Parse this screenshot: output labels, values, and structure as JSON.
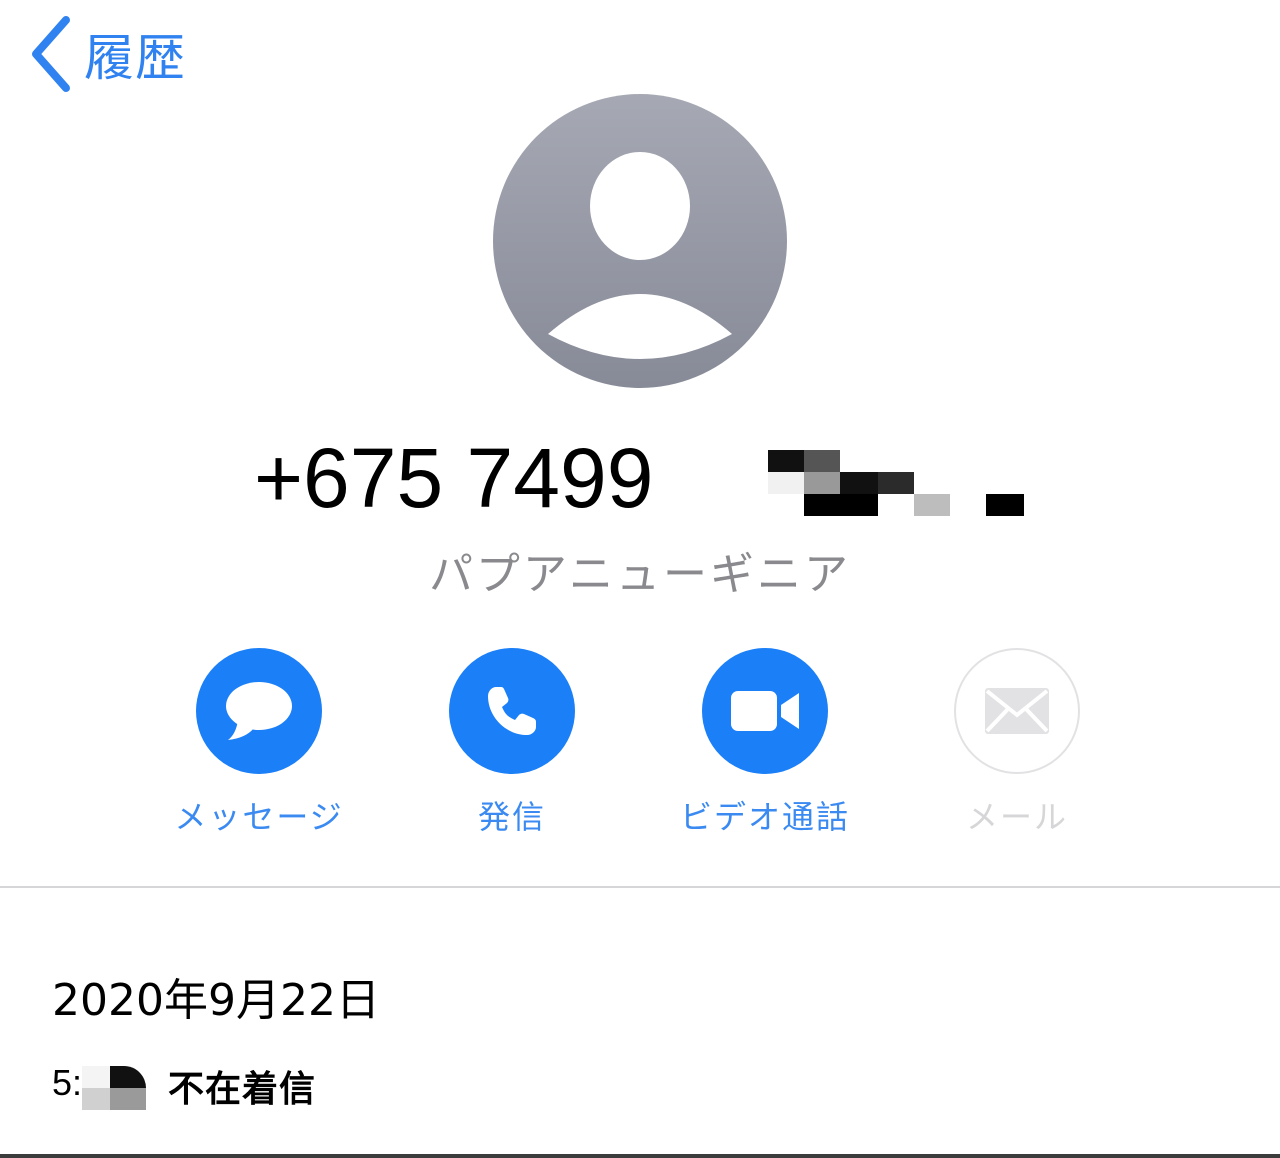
{
  "nav": {
    "back_label": "履歴"
  },
  "contact": {
    "phone_number": "+675 7499",
    "country": "パプアニューギニア"
  },
  "actions": [
    {
      "label": "メッセージ",
      "icon": "message-bubble-icon",
      "enabled": true
    },
    {
      "label": "発信",
      "icon": "phone-icon",
      "enabled": true
    },
    {
      "label": "ビデオ通話",
      "icon": "video-camera-icon",
      "enabled": true
    },
    {
      "label": "メール",
      "icon": "envelope-icon",
      "enabled": false
    }
  ],
  "history": {
    "date": "2020年9月22日",
    "calls": [
      {
        "time": "5:",
        "status": "不在着信"
      }
    ]
  },
  "colors": {
    "accent": "#1b7ff7",
    "label_blue": "#3a8af1",
    "secondary_text": "#8a8a8e",
    "disabled": "#d6d6d8"
  }
}
